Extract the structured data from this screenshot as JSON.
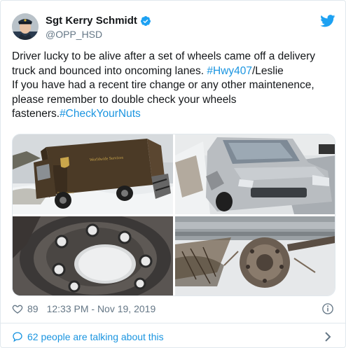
{
  "author": {
    "name": "Sgt Kerry Schmidt",
    "handle": "@OPP_HSD"
  },
  "tweet": {
    "line1": "Driver lucky to be alive after a set of wheels came off a delivery",
    "line2_text": "truck and bounced into oncoming lanes. ",
    "line2_hashtag": "#Hwy407",
    "line2_suffix": "/Leslie",
    "line3": "If you have had a recent tire change or any other maintenence,",
    "line4": "please remember to double check your wheels",
    "line5_text": "fasteners.",
    "line5_hashtag": "#CheckYourNuts"
  },
  "truck_text": {
    "side_label": "Worldwide Services",
    "door_label": "Package Delivery"
  },
  "meta": {
    "likes": "89",
    "timestamp": "12:33 PM - Nov 19, 2019"
  },
  "conversation": {
    "label": "62 people are talking about this"
  },
  "colors": {
    "link": "#1b95e0",
    "secondary_text": "#657786",
    "border": "#e1e8ed",
    "twitter_blue": "#1da1f2"
  },
  "icons": [
    "verified-icon",
    "twitter-bird-icon",
    "heart-icon",
    "info-icon",
    "speech-bubble-icon",
    "chevron-right-icon"
  ]
}
